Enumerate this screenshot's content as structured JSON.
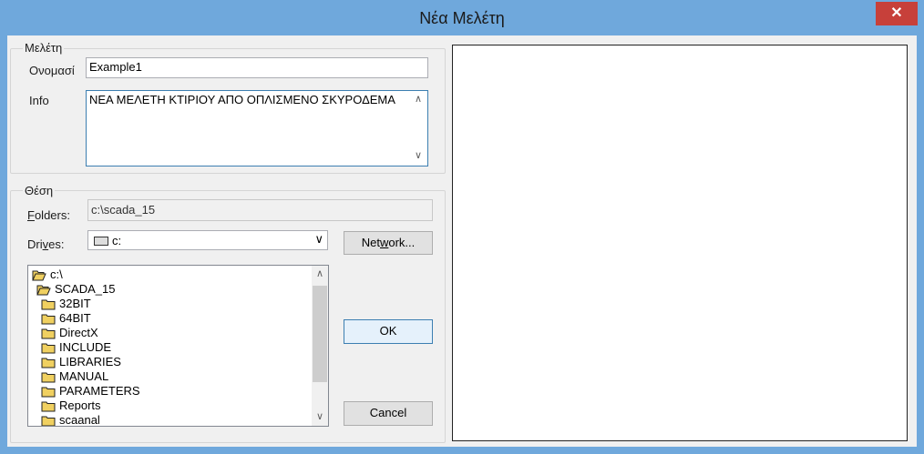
{
  "window": {
    "title": "Νέα Μελέτη",
    "close_glyph": "✕"
  },
  "study_group": {
    "label": "Μελέτη",
    "name_label": "Ονομασί",
    "name_value": "Example1",
    "info_label": "Info",
    "info_value": "ΝΕΑ ΜΕΛΕΤΗ ΚΤΙΡΙΟΥ ΑΠΟ ΟΠΛΙΣΜΕΝΟ ΣΚΥΡΟΔΕΜΑ"
  },
  "location_group": {
    "label": "Θέση",
    "folders_label_ul": "F",
    "folders_label_rest": "olders:",
    "folders_value": "c:\\scada_15",
    "drives_label_pre": "Dri",
    "drives_label_ul": "v",
    "drives_label_rest": "es:",
    "drives_value": "c:",
    "network_button_pre": "Net",
    "network_button_ul": "w",
    "network_button_rest": "ork...",
    "folder_list": [
      {
        "name": "c:\\",
        "open": true,
        "indent": 0
      },
      {
        "name": "SCADA_15",
        "open": true,
        "indent": 1
      },
      {
        "name": "32BIT",
        "open": false,
        "indent": 2
      },
      {
        "name": "64BIT",
        "open": false,
        "indent": 2
      },
      {
        "name": "DirectX",
        "open": false,
        "indent": 2
      },
      {
        "name": "INCLUDE",
        "open": false,
        "indent": 2
      },
      {
        "name": "LIBRARIES",
        "open": false,
        "indent": 2
      },
      {
        "name": "MANUAL",
        "open": false,
        "indent": 2
      },
      {
        "name": "PARAMETERS",
        "open": false,
        "indent": 2
      },
      {
        "name": "Reports",
        "open": false,
        "indent": 2
      },
      {
        "name": "scaanal",
        "open": false,
        "indent": 2
      }
    ]
  },
  "buttons": {
    "ok": "OK",
    "cancel": "Cancel"
  },
  "colors": {
    "titlebar": "#6fa8dc",
    "close": "#c7403a",
    "focus_border": "#3c7fb1",
    "folder": "#f0d060"
  },
  "icons": {
    "drive": "drive-icon",
    "folder": "folder-icon",
    "open_folder": "open-folder-icon",
    "close": "close-icon"
  }
}
